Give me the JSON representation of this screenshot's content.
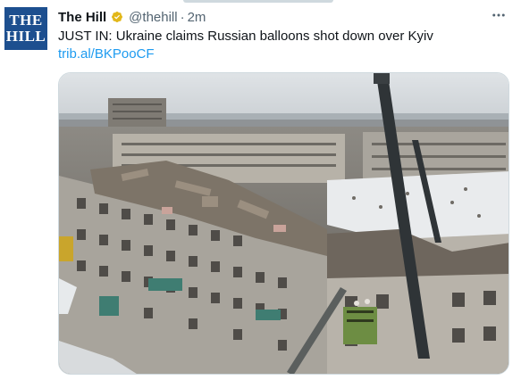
{
  "tweet": {
    "author_name": "The Hill",
    "author_handle": "@thehill",
    "separator": "·",
    "timestamp": "2m",
    "avatar_text": [
      "THE",
      "HILL"
    ],
    "text": "JUST IN: Ukraine claims Russian balloons shot down over Kyiv",
    "link": "trib.al/BKPooCF",
    "more_icon": "ellipsis-icon",
    "verified_icon": "verified-badge-icon",
    "media_icon": "news-photo"
  },
  "colors": {
    "text": "#0f1419",
    "secondary": "#536471",
    "link": "#1d9bf0",
    "avatar_bg": "#1d4f8f",
    "verified": "#e2b719"
  }
}
